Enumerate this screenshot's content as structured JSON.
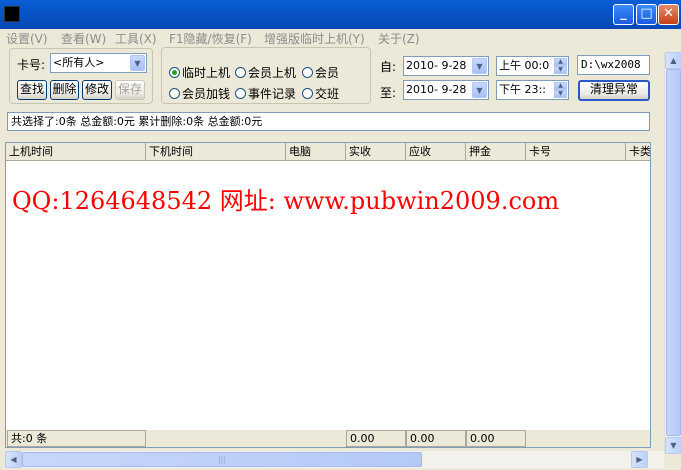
{
  "menu": [
    "设置(V)",
    "查看(W)",
    "工具(X)",
    "F1隐藏/恢复(F)",
    "增强版临时上机(Y)",
    "关于(Z)"
  ],
  "window_buttons": {
    "minimize": "_",
    "maximize": "□",
    "close": "✕"
  },
  "filter": {
    "card_label": "卡号:",
    "card_value": "<所有人>",
    "find": "查找",
    "delete": "删除",
    "modify": "修改",
    "save": "保存"
  },
  "options": {
    "temp_login": "临时上机",
    "member_login": "会员上机",
    "member": "会员",
    "member_topup": "会员加钱",
    "event_log": "事件记录",
    "handover": "交班"
  },
  "date_range": {
    "from_label": "自:",
    "to_label": "至:",
    "from_date": "2010- 9-28",
    "to_date": "2010- 9-28",
    "from_time": "上午 00:0",
    "to_time": "下午 23::"
  },
  "path": "D:\\wx2008",
  "clear_button": "清理异常",
  "summary": "共选择了:0条 总金额:0元 累计删除:0条 总金额:0元",
  "table": {
    "columns": [
      "上机时间",
      "下机时间",
      "电脑",
      "实收",
      "应收",
      "押金",
      "卡号",
      "卡类"
    ]
  },
  "watermark": "QQ:1264648542 网址: www.pubwin2009.com",
  "footer": {
    "total": "共:0 条",
    "received": "0.00",
    "receivable": "0.00",
    "deposit": "0.00"
  },
  "scroll_icons": {
    "up": "▲",
    "down": "▼",
    "left": "◀",
    "right": "▶",
    "grip": "|||"
  }
}
